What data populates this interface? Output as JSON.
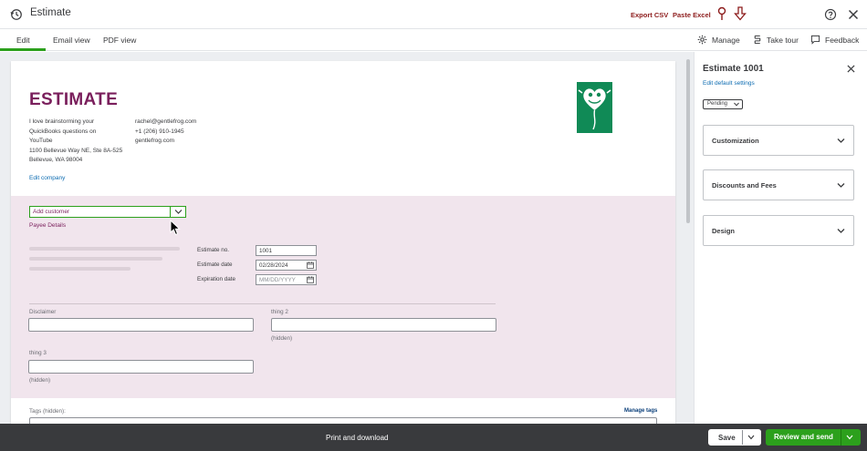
{
  "topbar": {
    "title": "Estimate",
    "export_csv": "Export CSV",
    "paste_excel": "Paste Excel"
  },
  "tabs": [
    {
      "label": "Edit",
      "active": true
    },
    {
      "label": "Email view",
      "active": false
    },
    {
      "label": "PDF view",
      "active": false
    }
  ],
  "toolbar": {
    "manage": "Manage",
    "take_tour": "Take tour",
    "feedback": "Feedback"
  },
  "estimate": {
    "heading": "ESTIMATE",
    "company_lines": [
      "I love brainstorming your",
      "QuickBooks questions on",
      "YouTube",
      "1100 Bellevue Way NE, Ste 8A-525",
      "Bellevue, WA 98004"
    ],
    "contact_lines": [
      "rachel@gentlefrog.com",
      "+1 (206) 910-1945",
      "gentlefrog.com"
    ],
    "edit_company": "Edit company"
  },
  "customer": {
    "placeholder": "Add customer",
    "payee_details": "Payee Details"
  },
  "meta": {
    "estimate_no_label": "Estimate no.",
    "estimate_no_value": "1001",
    "estimate_date_label": "Estimate date",
    "estimate_date_value": "02/28/2024",
    "expiration_label": "Expiration date",
    "expiration_placeholder": "MM/DD/YYYY"
  },
  "custom_fields": {
    "disclaimer_label": "Disclaimer",
    "thing2_label": "thing 2",
    "thing2_note": "(hidden)",
    "thing3_label": "thing 3",
    "thing3_note": "(hidden)"
  },
  "tags": {
    "label": "Tags (hidden):",
    "manage": "Manage tags"
  },
  "panel": {
    "title": "Estimate 1001",
    "subtitle": "Edit default settings",
    "status": "Pending",
    "sections": [
      "Customization",
      "Discounts and Fees",
      "Design"
    ]
  },
  "bottombar": {
    "print_download": "Print and download",
    "save": "Save",
    "review_send": "Review and send"
  },
  "colors": {
    "brand_title": "#7a1f5c",
    "accent_green": "#2ca01c",
    "pink_section": "#f1e5ed",
    "logo_green": "#108a56",
    "link_blue": "#0b6bb1",
    "bottom_bar": "#393a3d",
    "topbar_red_text": "#8d1c1c"
  },
  "icons": {
    "history": "history-icon",
    "pin": "pin-icon",
    "arrow_down": "arrow-down-icon",
    "help": "help-icon",
    "close": "close-icon",
    "gear": "gear-icon",
    "tour": "tour-icon",
    "feedback": "feedback-icon",
    "calendar": "calendar-icon",
    "chevron": "chevron-down-icon",
    "logo": "frog-heart-logo"
  }
}
